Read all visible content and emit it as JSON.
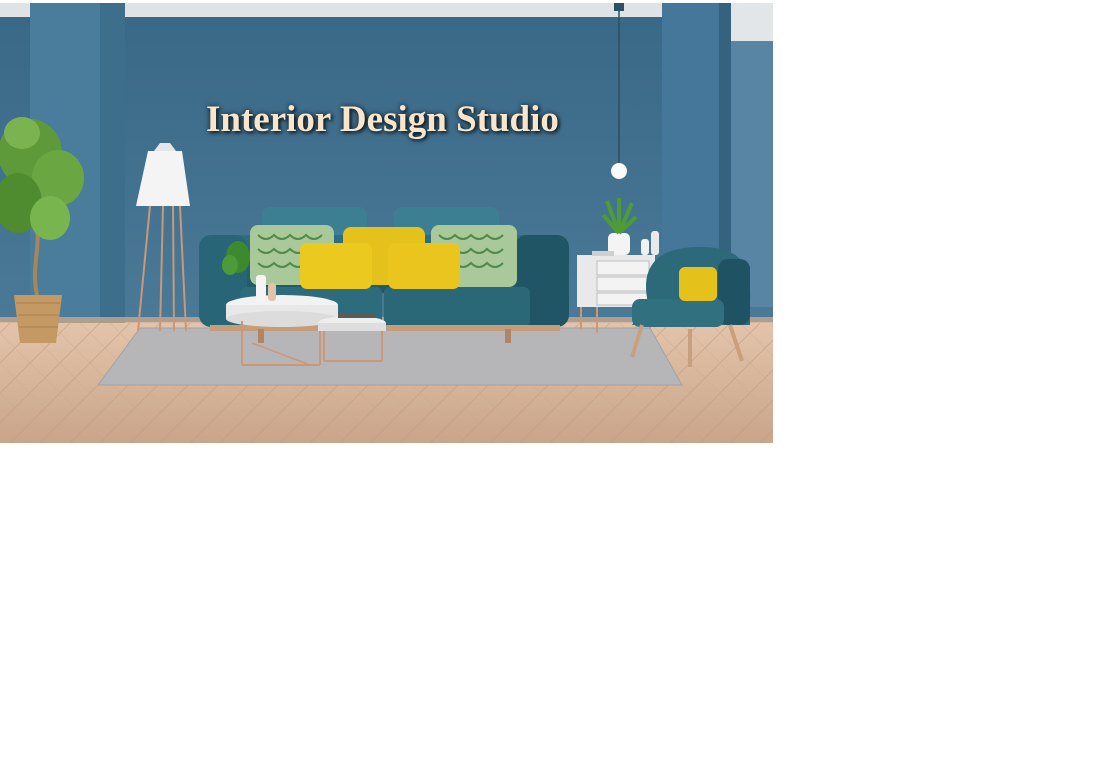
{
  "hero": {
    "title": "Interior Design Studio"
  },
  "colors": {
    "wall": "#3f6f8e",
    "sofa": "#2a6574",
    "pillow_yellow": "#e7c61a",
    "pillow_green": "#8fb57b",
    "floor": "#d7b59c",
    "rug": "#b9b9bb",
    "title_text": "#f7e6cc"
  }
}
